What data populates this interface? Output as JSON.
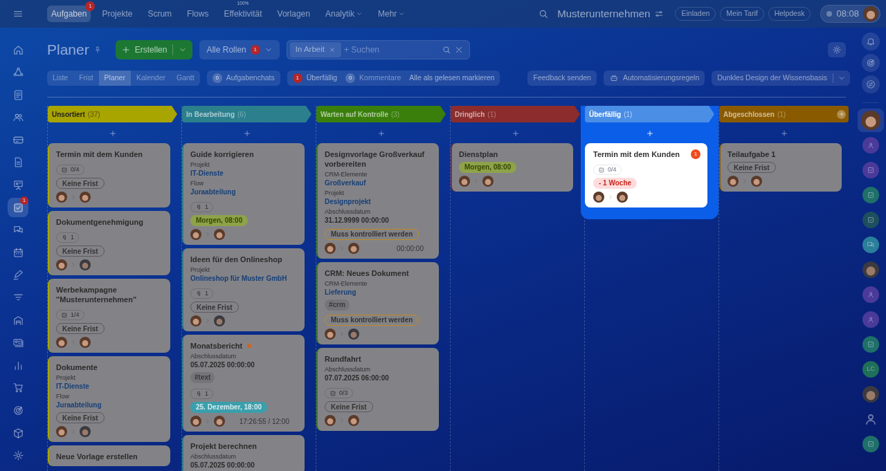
{
  "top_bar": {
    "nav": [
      {
        "label": "Aufgaben",
        "selected": true,
        "badge": "1"
      },
      {
        "label": "Projekte",
        "selected": false
      },
      {
        "label": "Scrum",
        "selected": false
      },
      {
        "label": "Flows",
        "selected": false
      },
      {
        "label": "Effektivität",
        "selected": false,
        "note": "100%"
      },
      {
        "label": "Vorlagen",
        "selected": false
      },
      {
        "label": "Analytik",
        "selected": false,
        "dropdown": true
      },
      {
        "label": "Mehr",
        "selected": false,
        "dropdown": true
      }
    ],
    "company": "Musterunternehmen",
    "buttons": [
      "Einladen",
      "Mein Tarif",
      "Helpdesk"
    ],
    "clock": "08:08"
  },
  "left_rail": [
    {
      "kind": "home",
      "selected": false
    },
    {
      "kind": "flow",
      "selected": false
    },
    {
      "kind": "news",
      "selected": false
    },
    {
      "kind": "people",
      "selected": false
    },
    {
      "kind": "card",
      "selected": false
    },
    {
      "kind": "doc",
      "selected": false
    },
    {
      "kind": "board",
      "selected": false
    },
    {
      "kind": "tasks",
      "selected": true,
      "badge": "1"
    },
    {
      "kind": "chat",
      "selected": false
    },
    {
      "kind": "calendar",
      "selected": false
    },
    {
      "kind": "pen",
      "selected": false
    },
    {
      "kind": "filter",
      "selected": false
    },
    {
      "kind": "garage",
      "selected": false
    },
    {
      "kind": "contact",
      "selected": false
    },
    {
      "kind": "chart",
      "selected": false
    },
    {
      "kind": "cart",
      "selected": false
    },
    {
      "kind": "target",
      "selected": false
    },
    {
      "kind": "box",
      "selected": false
    },
    {
      "kind": "gear",
      "selected": false
    }
  ],
  "right_tools": [
    {
      "kind": "bell"
    },
    {
      "kind": "target"
    },
    {
      "kind": "switch"
    }
  ],
  "recent_chats": [
    {
      "kind": "avatar",
      "selected": true
    },
    {
      "kind": "doc",
      "selected": false,
      "color": "#4a3a9a"
    },
    {
      "kind": "check",
      "selected": false,
      "color": "#4a3a9a"
    },
    {
      "kind": "check",
      "selected": false,
      "color": "#1f6f6a"
    },
    {
      "kind": "check",
      "selected": false,
      "color": "#1d4f5e"
    },
    {
      "kind": "chat",
      "selected": false,
      "color": "#2a7f9a"
    },
    {
      "kind": "avatar",
      "selected": false
    },
    {
      "kind": "doc",
      "selected": false,
      "color": "#4a3a9a"
    },
    {
      "kind": "doc",
      "selected": false,
      "color": "#4a3a9a"
    },
    {
      "kind": "check",
      "selected": false,
      "color": "#1f6f6a"
    },
    {
      "kind": "initials",
      "selected": false,
      "label": "LC",
      "color": "#1f6f5a"
    },
    {
      "kind": "avatar",
      "selected": false
    },
    {
      "kind": "group",
      "selected": false
    },
    {
      "kind": "check",
      "selected": false,
      "color": "#1f6f6a"
    }
  ],
  "page": {
    "title": "Planer",
    "create": "Erstellen",
    "roles": {
      "label": "Alle Rollen",
      "badge": "1"
    },
    "search": {
      "chip": "In Arbeit",
      "placeholder": "+ Suchen"
    }
  },
  "view_tabs": [
    {
      "label": "Liste",
      "selected": false
    },
    {
      "label": "Frist",
      "selected": false
    },
    {
      "label": "Planer",
      "selected": true
    },
    {
      "label": "Kalender",
      "selected": false
    },
    {
      "label": "Gantt",
      "selected": false
    }
  ],
  "chats": {
    "count": "0",
    "label": "Aufgabenchats"
  },
  "counters": [
    {
      "count": "1",
      "label": "Überfällig",
      "kind": "alert"
    },
    {
      "count": "0",
      "label": "Kommentare",
      "kind": "muted"
    }
  ],
  "mark_read": "Alle als gelesen markieren",
  "actions": {
    "feedback": "Feedback senden",
    "automation": "Automatisierungsregeln",
    "theme": "Dunkles Design der Wissensbasis"
  },
  "columns": [
    {
      "title": "Unsortiert",
      "count": "(37)",
      "color": "#a8a400",
      "highlighted": false,
      "cards": [
        {
          "title": "Termin mit dem Kunden",
          "people": true,
          "rows": [
            {
              "kind": "checklist",
              "text": "0/4"
            },
            {
              "kind": "nodeadline",
              "text": "Keine Frist"
            }
          ]
        },
        {
          "title": "Dokumentgenehmigung",
          "people": true,
          "rows": [
            {
              "kind": "files",
              "text": "1"
            },
            {
              "kind": "nodeadline",
              "text": "Keine Frist"
            }
          ]
        },
        {
          "title": "Werbekampagne \"Musterunternehmen\"",
          "people": true,
          "rows": [
            {
              "kind": "checklist",
              "text": "1/4"
            },
            {
              "kind": "nodeadline",
              "text": "Keine Frist"
            }
          ]
        },
        {
          "title": "Dokumente",
          "people": true,
          "rows": [
            {
              "kind": "field",
              "label": "Projekt",
              "value": "IT-Dienste",
              "link": true
            },
            {
              "kind": "field",
              "label": "Flow",
              "value": "Juraabteilung",
              "link": true
            },
            {
              "kind": "nodeadline",
              "text": "Keine Frist"
            }
          ]
        },
        {
          "title": "Neue Vorlage erstellen"
        }
      ]
    },
    {
      "title": "In Bearbeitung",
      "count": "(6)",
      "color": "#2c7f8c",
      "highlighted": false,
      "cards": [
        {
          "title": "Guide korrigieren",
          "people": true,
          "rows": [
            {
              "kind": "field",
              "label": "Projekt",
              "value": "IT-Dienste",
              "link": true
            },
            {
              "kind": "field",
              "label": "Flow",
              "value": "Juraabteilung",
              "link": true
            },
            {
              "kind": "files",
              "text": "1"
            },
            {
              "kind": "soon",
              "text": "Morgen, 08:00"
            }
          ]
        },
        {
          "title": "Ideen für den Onlineshop",
          "people": true,
          "rows": [
            {
              "kind": "field",
              "label": "Projekt",
              "value": "Onlineshop für Muster GmbH",
              "link": true
            },
            {
              "kind": "files",
              "text": "1"
            },
            {
              "kind": "nodeadline",
              "text": "Keine Frist"
            }
          ]
        },
        {
          "title": "Monatsbericht",
          "people": true,
          "hot": true,
          "timer": "17:26:55 / 12:00",
          "rows": [
            {
              "kind": "field",
              "label": "Abschlussdatum",
              "value": "05.07.2025 00:00:00",
              "link": false
            },
            {
              "kind": "tag",
              "text": "#text"
            },
            {
              "kind": "files",
              "text": "1"
            },
            {
              "kind": "due",
              "text": "25. Dezember, 18:00"
            }
          ]
        },
        {
          "title": "Projekt berechnen",
          "rows": [
            {
              "kind": "field",
              "label": "Abschlussdatum",
              "value": "05.07.2025 00:00:00",
              "link": false
            }
          ]
        }
      ]
    },
    {
      "title": "Warten auf Kontrolle",
      "count": "(3)",
      "color": "#3a7f0c",
      "highlighted": false,
      "cards": [
        {
          "title": "Designvorlage Großverkauf vorbereiten",
          "people": true,
          "timer": "00:00:00",
          "rows": [
            {
              "kind": "field",
              "label": "CRM-Elemente",
              "value": "Großverkauf",
              "link": true
            },
            {
              "kind": "field",
              "label": "Projekt",
              "value": "Designprojekt",
              "link": true
            },
            {
              "kind": "field",
              "label": "Abschlussdatum",
              "value": "31.12.9999 00:00:00",
              "link": false
            },
            {
              "kind": "control",
              "text": "Muss kontrolliert werden"
            }
          ]
        },
        {
          "title": "CRM: Neues Dokument",
          "people": true,
          "rows": [
            {
              "kind": "field",
              "label": "CRM-Elemente",
              "value": "Lieferung",
              "link": true
            },
            {
              "kind": "tag",
              "text": "#crm"
            },
            {
              "kind": "control",
              "text": "Muss kontrolliert werden"
            }
          ]
        },
        {
          "title": "Rundfahrt",
          "people": true,
          "rows": [
            {
              "kind": "field",
              "label": "Abschlussdatum",
              "value": "07.07.2025 06:00:00",
              "link": false
            },
            {
              "kind": "checklist",
              "text": "0/3"
            },
            {
              "kind": "nodeadline",
              "text": "Keine Frist"
            }
          ]
        }
      ]
    },
    {
      "title": "Dringlich",
      "count": "(1)",
      "color": "#8c2c2c",
      "highlighted": false,
      "cards": [
        {
          "title": "Dienstplan",
          "people": true,
          "rows": [
            {
              "kind": "soon",
              "text": "Morgen, 08:00"
            }
          ]
        }
      ]
    },
    {
      "title": "Überfällig",
      "count": "(1)",
      "color": "#4a8ee6",
      "highlighted": true,
      "cards": [
        {
          "title": "Termin mit dem Kunden",
          "people": true,
          "badge": "1",
          "rows": [
            {
              "kind": "checklist",
              "text": "0/4"
            },
            {
              "kind": "overdue",
              "text": "- 1 Woche"
            }
          ]
        }
      ]
    },
    {
      "title": "Abgeschlossen",
      "count": "(1)",
      "color": "#8a5a00",
      "highlighted": false,
      "add_button": true,
      "cards": [
        {
          "title": "Teilaufgabe 1",
          "people": true,
          "rows": [
            {
              "kind": "nodeadline",
              "text": "Keine Frist"
            }
          ]
        }
      ]
    }
  ]
}
